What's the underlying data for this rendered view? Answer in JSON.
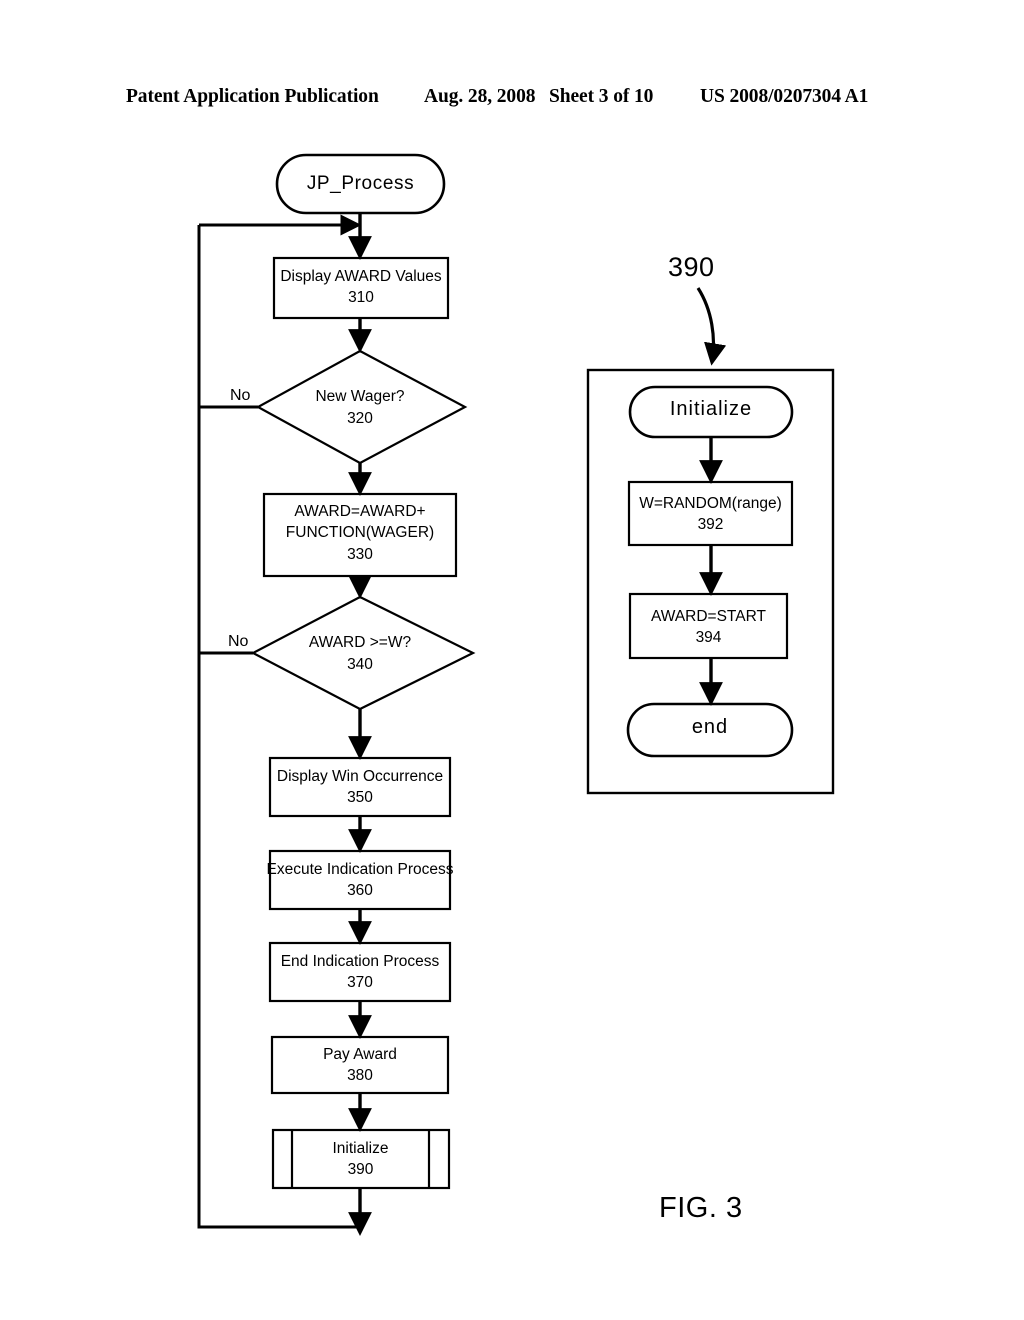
{
  "header": {
    "publication": "Patent Application Publication",
    "date": "Aug. 28, 2008",
    "sheet": "Sheet 3 of 10",
    "patent_number": "US 2008/0207304 A1"
  },
  "figure": {
    "caption": "FIG. 3",
    "callout": "390"
  },
  "colors": {
    "ink": "#000000",
    "paper": "#ffffff"
  },
  "main_flow": {
    "start": {
      "label": "JP_Process",
      "shape": "stadium"
    },
    "nodes": [
      {
        "id": "310",
        "shape": "process",
        "text": "Display AWARD Values",
        "ref": "310"
      },
      {
        "id": "320",
        "shape": "decision",
        "text": "New Wager?",
        "ref": "320",
        "no_label": "No"
      },
      {
        "id": "330",
        "shape": "process",
        "text": "AWARD=AWARD+\nFUNCTION(WAGER)",
        "ref": "330"
      },
      {
        "id": "340",
        "shape": "decision",
        "text": "AWARD >=W?",
        "ref": "340",
        "no_label": "No"
      },
      {
        "id": "350",
        "shape": "process",
        "text": "Display Win Occurrence",
        "ref": "350"
      },
      {
        "id": "360",
        "shape": "process",
        "text": "Execute Indication Process",
        "ref": "360"
      },
      {
        "id": "370",
        "shape": "process",
        "text": "End Indication Process",
        "ref": "370"
      },
      {
        "id": "380",
        "shape": "process",
        "text": "Pay Award",
        "ref": "380"
      },
      {
        "id": "390",
        "shape": "predefined",
        "text": "Initialize",
        "ref": "390"
      }
    ]
  },
  "subprocess": {
    "callout_ref": "390",
    "nodes": [
      {
        "id": "sp-start",
        "shape": "stadium",
        "text": "Initialize"
      },
      {
        "id": "392",
        "shape": "process",
        "text": "W=RANDOM(range)",
        "ref": "392"
      },
      {
        "id": "394",
        "shape": "process",
        "text": "AWARD=START",
        "ref": "394"
      },
      {
        "id": "sp-end",
        "shape": "stadium",
        "text": "end"
      }
    ]
  }
}
